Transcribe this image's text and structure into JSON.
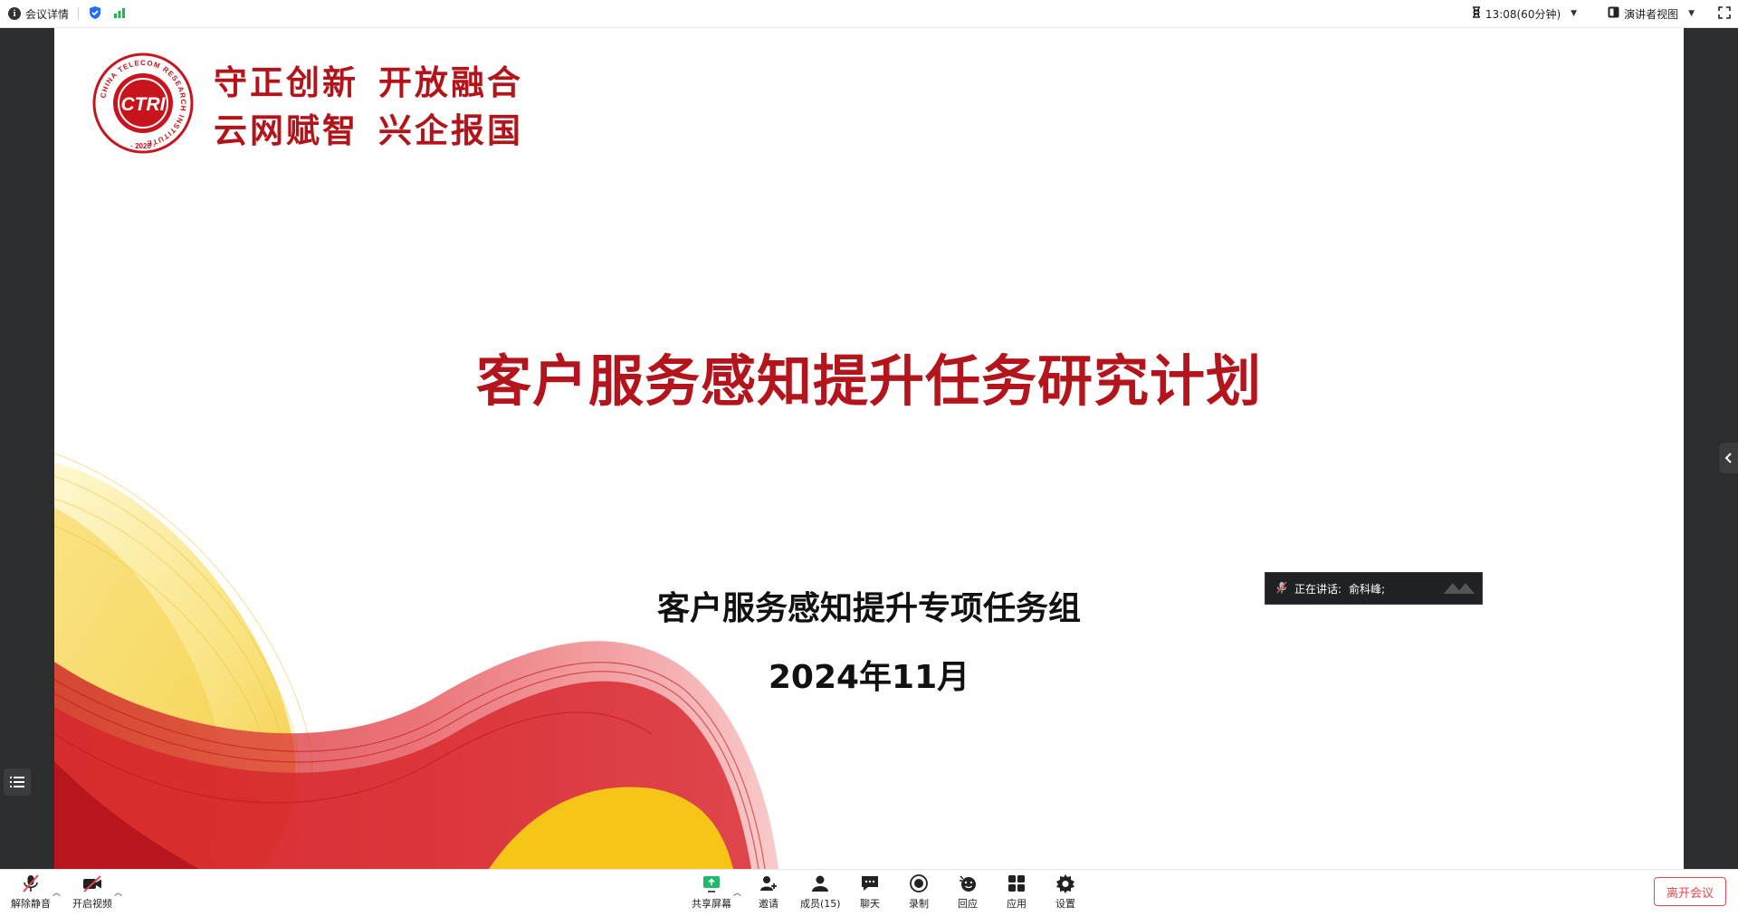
{
  "topbar": {
    "meeting_info_label": "会议详情",
    "timer_label": "13:08(60分钟)",
    "view_label": "演讲者视图",
    "icons": [
      "info-icon",
      "shield-icon",
      "signal-icon",
      "hourglass-icon",
      "layout-icon",
      "fullscreen-icon"
    ]
  },
  "slide": {
    "logo_text": "CTRI",
    "logo_ring_text": "CHINA TELECOM RESEARCH INSTITUTE",
    "logo_year": "2020",
    "motto_line1_a": "守正创新",
    "motto_line1_b": "开放融合",
    "motto_line2_a": "云网赋智",
    "motto_line2_b": "兴企报国",
    "title": "客户服务感知提升任务研究计划",
    "subtitle": "客户服务感知提升专项任务组",
    "date": "2024年11月"
  },
  "speaking": {
    "label": "正在讲话:",
    "speaker": "俞科峰;"
  },
  "toolbar": {
    "unmute": "解除静音",
    "start_video": "开启视频",
    "share_screen": "共享屏幕",
    "invite": "邀请",
    "members": "成员(15)",
    "chat": "聊天",
    "record": "录制",
    "react": "回应",
    "apps": "应用",
    "settings": "设置",
    "leave": "离开会议"
  },
  "colors": {
    "brand_red": "#b4141b",
    "leave_red": "#e5484d",
    "stage_bg": "#2b2d2f",
    "share_green": "#1fb96b"
  }
}
